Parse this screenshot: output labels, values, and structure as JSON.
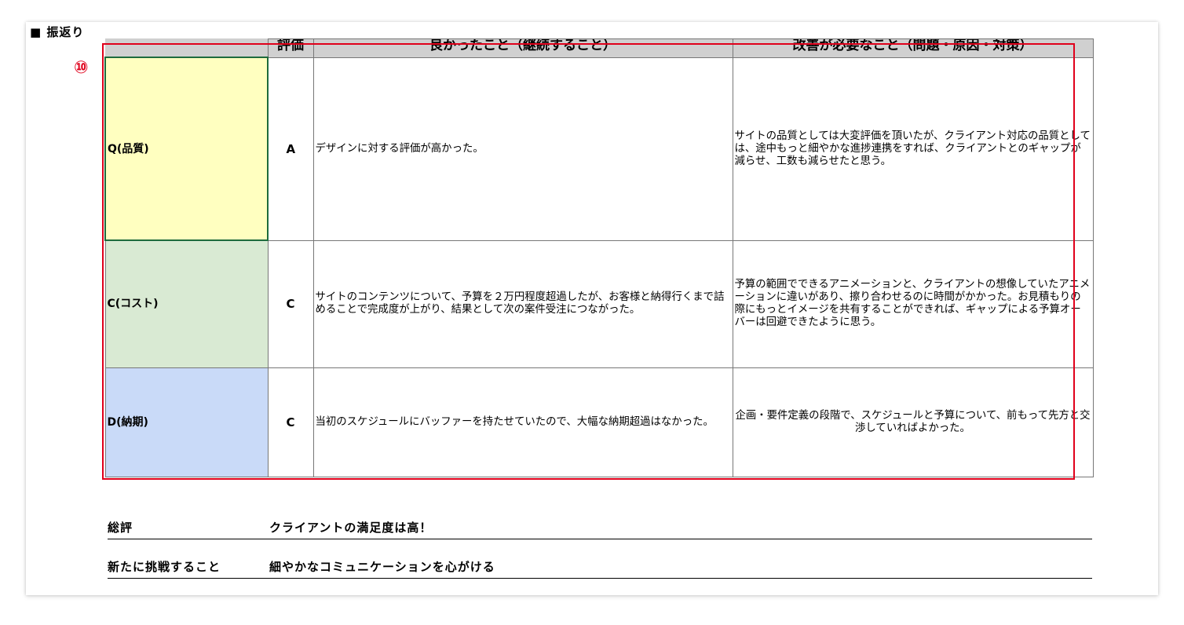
{
  "section": {
    "title": "■ 振返り"
  },
  "marker": {
    "label": "⑩",
    "color": "#e0001b"
  },
  "table": {
    "headers": {
      "blank": "",
      "grade": "評価",
      "good": "良かったこと（継続すること）",
      "improve": "改善が必要なこと（問題・原因・対策）"
    },
    "rows": [
      {
        "category": "Q(品質)",
        "grade": "A",
        "good": "デザインに対する評価が高かった。",
        "improve": "サイトの品質としては大変評価を頂いたが、クライアント対応の品質としては、途中もっと細やかな進捗連携をすれば、クライアントとのギャップが減らせ、工数も減らせたと思う。",
        "color": "#ffffc0"
      },
      {
        "category": "C(コスト)",
        "grade": "C",
        "good": "サイトのコンテンツについて、予算を２万円程度超過したが、お客様と納得行くまで詰めることで完成度が上がり、結果として次の案件受注につながった。",
        "improve": "予算の範囲でできるアニメーションと、クライアントの想像していたアニメーションに違いがあり、擦り合わせるのに時間がかかった。お見積もりの際にもっとイメージを共有することができれば、ギャップによる予算オーバーは回避できたように思う。",
        "color": "#d9ead3"
      },
      {
        "category": "D(納期)",
        "grade": "C",
        "good": "当初のスケジュールにバッファーを持たせていたので、大幅な納期超過はなかった。",
        "improve": "企画・要件定義の段階で、スケジュールと予算について、前もって先方と交渉していればよかった。",
        "color": "#c9daf8"
      }
    ]
  },
  "summary": {
    "overall_label": "総評",
    "overall_value": "クライアントの満足度は高！",
    "challenge_label": "新たに挑戦すること",
    "challenge_value": "細やかなコミュニケーションを心がける"
  }
}
